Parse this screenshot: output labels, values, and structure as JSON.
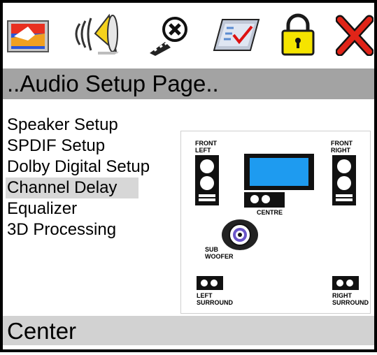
{
  "toolbar": {
    "icons": [
      {
        "name": "display-icon"
      },
      {
        "name": "speaker-audio-icon"
      },
      {
        "name": "film-reel-icon"
      },
      {
        "name": "preferences-checklist-icon"
      },
      {
        "name": "padlock-icon"
      },
      {
        "name": "exit-x-icon"
      }
    ]
  },
  "title": "..Audio Setup Page..",
  "menu": {
    "items": [
      {
        "label": "Speaker Setup",
        "selected": false
      },
      {
        "label": "SPDIF Setup",
        "selected": false
      },
      {
        "label": "Dolby Digital Setup",
        "selected": false
      },
      {
        "label": "Channel Delay",
        "selected": true
      },
      {
        "label": "Equalizer",
        "selected": false
      },
      {
        "label": "3D Processing",
        "selected": false
      }
    ]
  },
  "diagram": {
    "front_left": [
      "FRONT",
      "LEFT"
    ],
    "front_right": [
      "FRONT",
      "RIGHT"
    ],
    "centre": "CENTRE",
    "sub_woofer": [
      "SUB",
      "WOOFER"
    ],
    "left_surround": [
      "LEFT",
      "SURROUND"
    ],
    "right_surround": [
      "RIGHT",
      "SURROUND"
    ],
    "screen_color": "#1e9bf0"
  },
  "status": "Center"
}
